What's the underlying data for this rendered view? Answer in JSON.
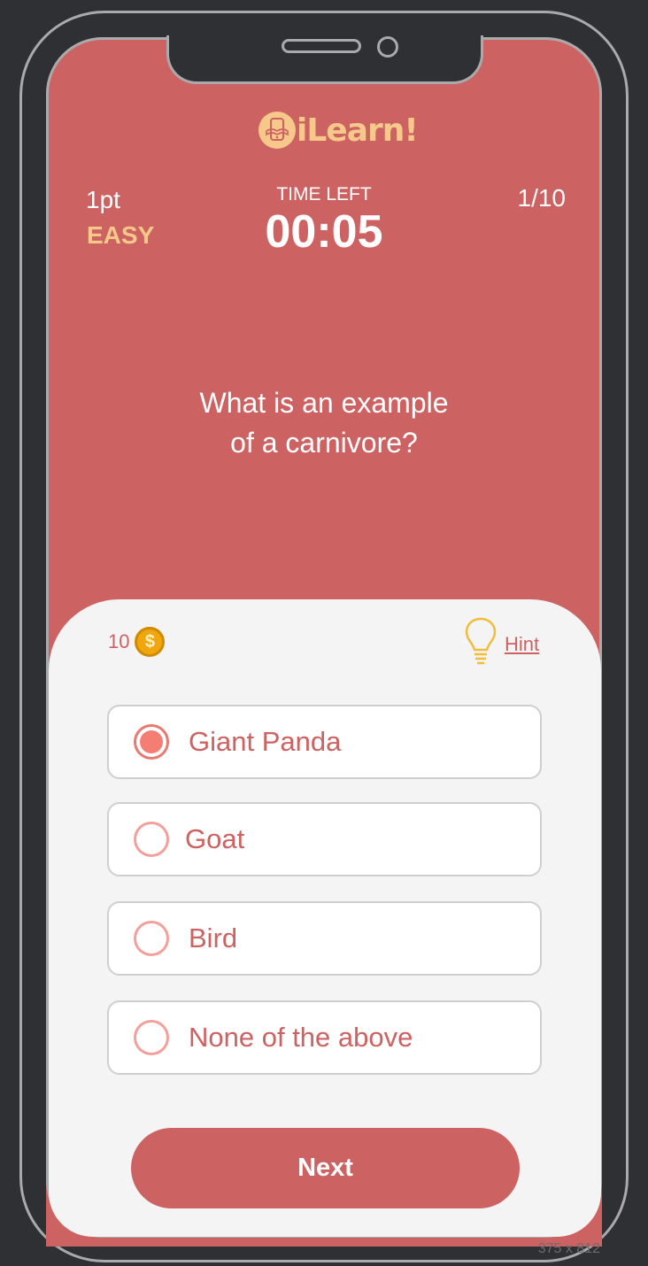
{
  "app": {
    "logo_text": "iLearn!"
  },
  "header": {
    "points": "1pt",
    "difficulty": "EASY",
    "time_label": "TIME LEFT",
    "timer": "00:05",
    "progress": "1/10"
  },
  "question": {
    "line1": "What is an example",
    "line2": "of a carnivore?"
  },
  "wallet": {
    "coins": "10",
    "coin_symbol": "$"
  },
  "hint": {
    "label": "Hint"
  },
  "options": [
    {
      "label": "Giant Panda",
      "selected": true
    },
    {
      "label": "Goat",
      "selected": false
    },
    {
      "label": "Bird",
      "selected": false
    },
    {
      "label": "None of the above",
      "selected": false
    }
  ],
  "actions": {
    "next_label": "Next"
  },
  "frame": {
    "size_label": "375 x 812"
  },
  "colors": {
    "background": "#cd6262",
    "accent": "#f6c98a",
    "panel": "#f4f4f4",
    "coin": "#f0a70f",
    "radio_selected": "#f47e74"
  },
  "icons": [
    "logo-book-phone-icon",
    "coin-icon",
    "lightbulb-icon",
    "radio-icon"
  ]
}
